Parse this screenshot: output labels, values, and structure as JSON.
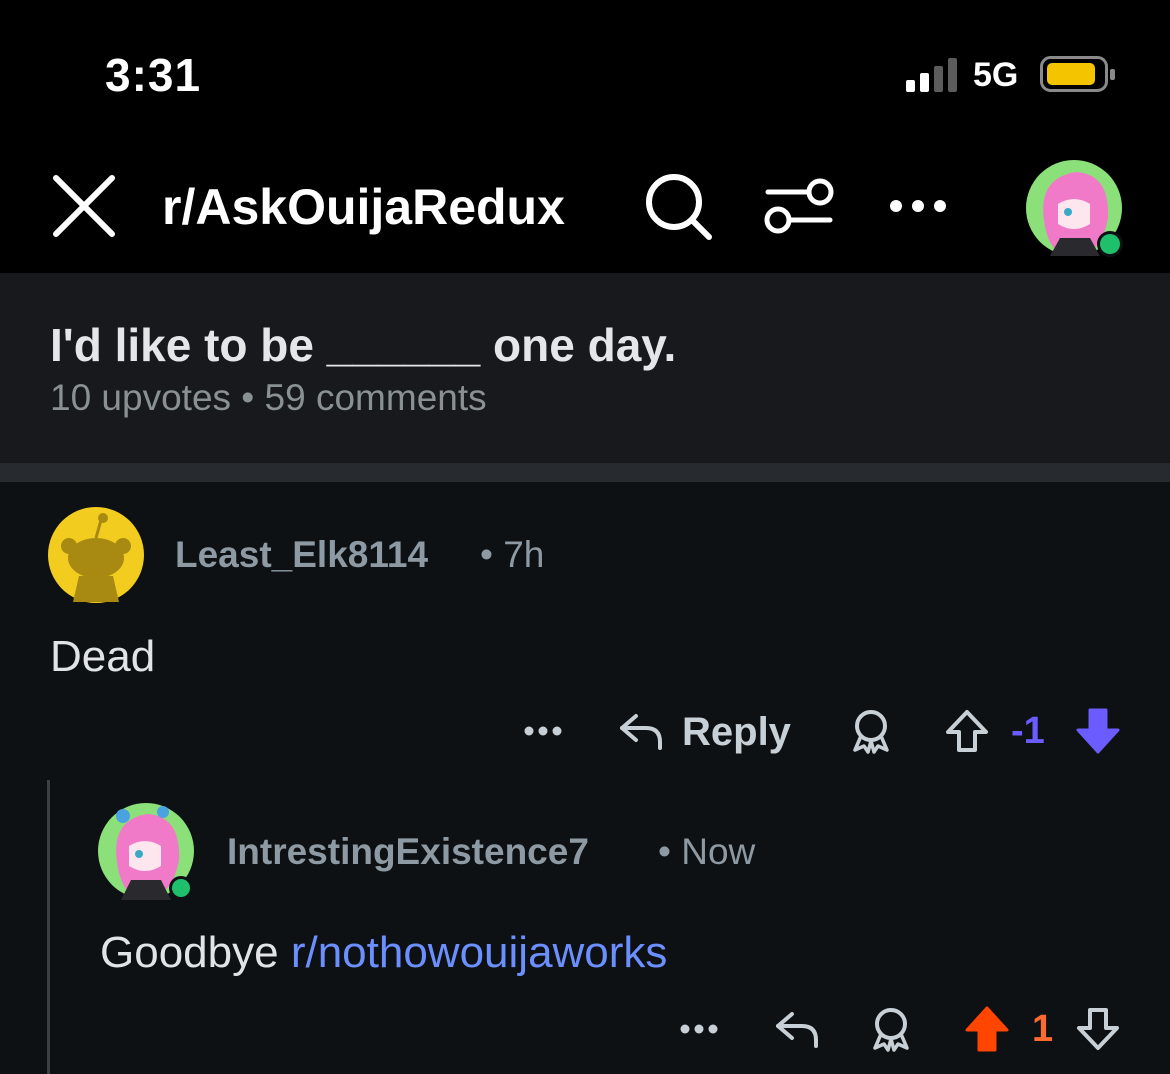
{
  "status_bar": {
    "time": "3:31",
    "network": "5G",
    "icons": [
      "cellular-signal-icon",
      "battery-icon"
    ],
    "battery_color": "#f5c400"
  },
  "nav": {
    "subreddit": "r/AskOuijaRedux",
    "icons": [
      "close-icon",
      "search-icon",
      "filter-icon",
      "more-icon",
      "user-avatar"
    ],
    "online_color": "#1ec06b"
  },
  "post": {
    "title": "I'd like to be ______ one day.",
    "meta": "10 upvotes • 59 comments"
  },
  "comments": [
    {
      "author": "Least_Elk8114",
      "time": "• 7h",
      "body": "Dead",
      "reply_label": "Reply",
      "score": "-1",
      "vote_state": "downvoted",
      "vote_color": "#6a5cff",
      "avatar": "snoo-avatar-yellow"
    },
    {
      "author": "IntrestingExistence7",
      "time": "• Now",
      "body": "Goodbye ",
      "link": "r/nothowouijaworks",
      "score": "1",
      "vote_state": "upvoted",
      "vote_color": "#ff4500",
      "avatar": "anime-girl-avatar"
    }
  ]
}
